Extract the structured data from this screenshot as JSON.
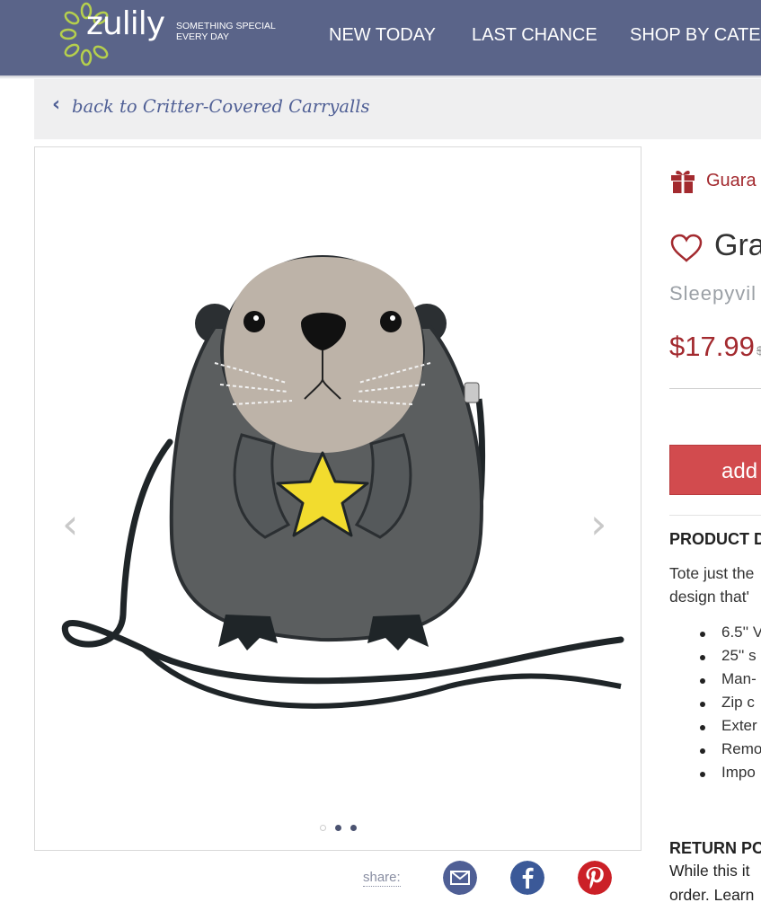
{
  "header": {
    "logo_text": "zulily",
    "tagline_line1": "SOMETHING SPECIAL",
    "tagline_line2": "EVERY DAY",
    "nav": [
      "NEW TODAY",
      "LAST CHANCE",
      "SHOP BY CATEG"
    ]
  },
  "breadcrumb": {
    "back_label": "back to Critter-Covered Carryalls"
  },
  "gallery": {
    "image_subject": "otter crossbody bag holding yellow star",
    "dots_total": 3,
    "active_dot": 1,
    "icons": [
      "chevron-left-icon",
      "chevron-right-icon"
    ]
  },
  "share": {
    "label": "share:",
    "icons": [
      "email-icon",
      "facebook-icon",
      "pinterest-icon"
    ]
  },
  "product": {
    "guarantee_text": "Guara",
    "title": "Gra",
    "brand": "Sleepyvil",
    "price": "$17.99",
    "original_price": "$",
    "add_button_label": "add",
    "details_heading": "PRODUCT D",
    "description_lines": [
      "Tote just the",
      "design that'"
    ],
    "bullets": [
      "6.5'' V",
      "25'' s",
      "Man-",
      "Zip c",
      "Exter",
      "Remo",
      "Impo"
    ],
    "return_heading": "RETURN PO",
    "return_lines": [
      "While this it",
      "order. Learn"
    ]
  },
  "colors": {
    "header_bg": "#5a6489",
    "accent_red": "#a32a2f",
    "button_red": "#d24b4e",
    "link_blue": "#4f5f95",
    "facebook_blue": "#3b5998",
    "pinterest_red": "#cb2027"
  }
}
